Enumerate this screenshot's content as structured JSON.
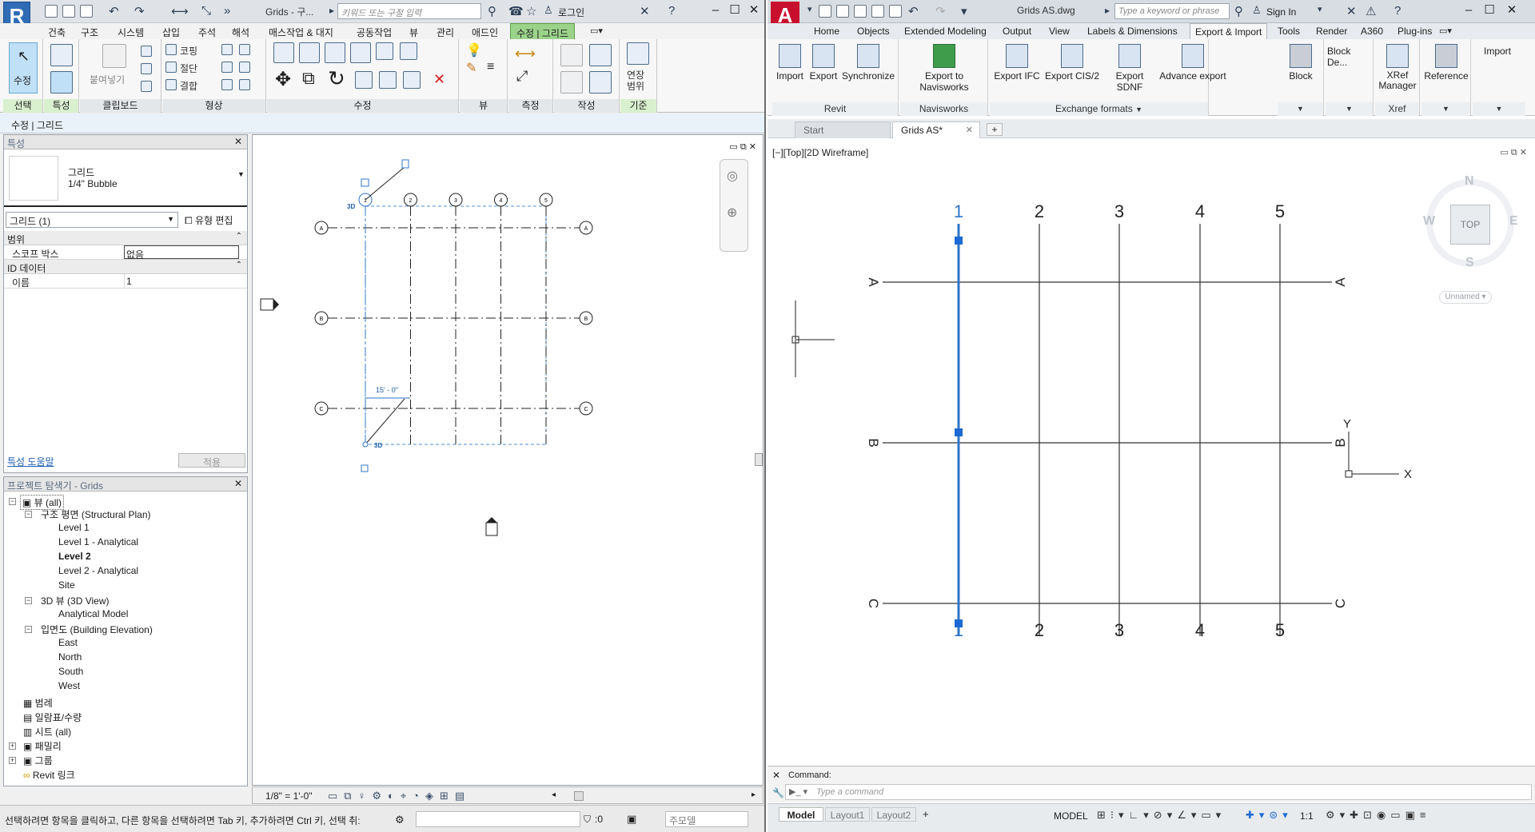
{
  "revit": {
    "title": "Grids - 구...",
    "search_placeholder": "키워드 또는 구절 입력",
    "signin": "로그인",
    "tabs": [
      "건축",
      "구조",
      "시스템",
      "삽입",
      "주석",
      "해석",
      "매스작업 & 대지",
      "공동작업",
      "뷰",
      "관리",
      "애드인",
      "수정 | 그리드"
    ],
    "ribbon": {
      "select_label": "수정",
      "panels": [
        "선택",
        "특성",
        "클립보드",
        "형상",
        "수정",
        "뷰",
        "측정",
        "작성",
        "기준"
      ],
      "paste_label": "붙여넣기",
      "cope_label": "코핑",
      "cut_label": "절단",
      "join_label": "결합",
      "extent_label": "연장\n범위"
    },
    "context_bar": "수정 | 그리드",
    "properties": {
      "header": "특성",
      "type_family": "그리드",
      "type_name": "1/4\" Bubble",
      "selector": "그리드 (1)",
      "edit_type": "유형 편집",
      "group_extents": "범위",
      "scope_box_label": "스코프 박스",
      "scope_box_value": "없음",
      "group_id": "ID 데이터",
      "name_label": "이름",
      "name_value": "1",
      "help_link": "특성 도움말",
      "apply": "적용"
    },
    "browser": {
      "header": "프로젝트 탐색기 - Grids",
      "items": {
        "views_all": "뷰 (all)",
        "structural_plan": "구조 평면 (Structural Plan)",
        "level1": "Level 1",
        "level1_analytical": "Level 1 - Analytical",
        "level2": "Level 2",
        "level2_analytical": "Level 2 - Analytical",
        "site": "Site",
        "view3d": "3D 뷰 (3D View)",
        "analytical_model": "Analytical Model",
        "elevation": "입면도 (Building Elevation)",
        "east": "East",
        "north": "North",
        "south": "South",
        "west": "West",
        "legends": "범례",
        "schedules": "일람표/수량",
        "sheets": "시트 (all)",
        "families": "패밀리",
        "groups": "그룹",
        "revit_links": "Revit 링크"
      }
    },
    "canvas": {
      "grid_cols": [
        "1",
        "2",
        "3",
        "4",
        "5"
      ],
      "grid_rows": [
        "A",
        "B",
        "C"
      ],
      "dimension": "15' - 0\"",
      "tag_3d": "3D"
    },
    "viewbar": {
      "scale": "1/8\" = 1'-0\""
    },
    "status": {
      "message": "선택하려면 항목을 클릭하고, 다른 항목을 선택하려면 Tab 키, 추가하려면 Ctrl 키, 선택 취:",
      "zero": ":0",
      "model": "주모델"
    }
  },
  "autocad": {
    "title": "Grids AS.dwg",
    "search_placeholder": "Type a keyword or phrase",
    "signin": "Sign In",
    "tabs": [
      "Home",
      "Objects",
      "Extended Modeling",
      "Output",
      "View",
      "Labels & Dimensions",
      "Export & Import",
      "Tools",
      "Render",
      "A360",
      "Plug-ins"
    ],
    "ribbon": {
      "revit_buttons": [
        "Import",
        "Export",
        "Synchronize"
      ],
      "navisworks_button": "Export to Navisworks",
      "exchange_buttons": [
        "Export IFC",
        "Export CIS/2",
        "Export SDNF",
        "Advance export"
      ],
      "block_button": "Block",
      "block_def": "Block De...",
      "xref_button": "XRef Manager",
      "reference_button": "Reference",
      "import_button": "Import",
      "panels": [
        "Revit",
        "Navisworks",
        "Exchange formats",
        "Xref"
      ]
    },
    "file_tabs": [
      "Start",
      "Grids AS*"
    ],
    "view_label": "[−][Top][2D Wireframe]",
    "viewcube": {
      "top": "TOP",
      "n": "N",
      "s": "S",
      "e": "E",
      "w": "W",
      "ucs": "Unnamed"
    },
    "grid": {
      "cols": [
        "1",
        "2",
        "3",
        "4",
        "5"
      ],
      "rows": [
        "A",
        "B",
        "C"
      ],
      "axis_x": "X",
      "axis_y": "Y"
    },
    "command": {
      "label": "Command:",
      "placeholder": "Type a command"
    },
    "layout_tabs": [
      "Model",
      "Layout1",
      "Layout2"
    ],
    "status": {
      "model": "MODEL",
      "scale": "1:1"
    }
  }
}
